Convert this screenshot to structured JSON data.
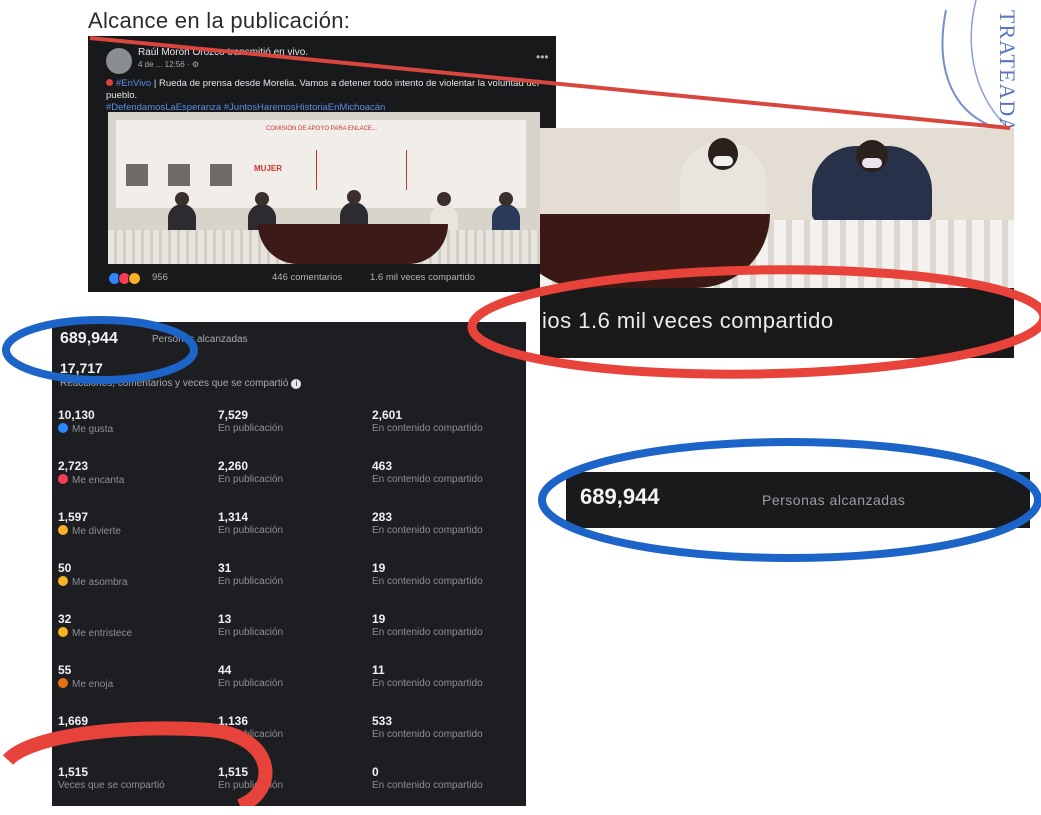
{
  "heading": "Alcance en la publicación:",
  "post": {
    "author": "Raúl Morón Orozco transmitió en vivo.",
    "time": "4 de ... 12:56 · ⚙",
    "live_tag": "#EnVivo",
    "text": "| Rueda de prensa desde Morelia. Vamos a detener todo intento de violentar la voluntad del pueblo.",
    "hashtags": "#DefendamosLaEsperanza #JuntosHaremosHistoriaEnMichoacán",
    "reaction_count": "956",
    "comments": "446 comentarios",
    "shares": "1.6 mil veces compartido",
    "banner_title": "COMISIÓN DE APOYO PARA ENLACE...",
    "banner_word": "MUJER"
  },
  "zoom_caption": "ios  1.6 mil veces compartido",
  "stats": {
    "reach_value": "689,944",
    "reach_label": "Personas alcanzadas",
    "engagement_value": "17,717",
    "engagement_label": "Reacciones, comentarios y veces que se compartió",
    "rows": [
      {
        "total": "10,130",
        "total_label": "Me gusta",
        "icon": "like-icon",
        "color": "#2d88ff",
        "post": "7,529",
        "post_label": "En publicación",
        "shared": "2,601",
        "shared_label": "En contenido compartido"
      },
      {
        "total": "2,723",
        "total_label": "Me encanta",
        "icon": "love-icon",
        "color": "#f33e58",
        "post": "2,260",
        "post_label": "En publicación",
        "shared": "463",
        "shared_label": "En contenido compartido"
      },
      {
        "total": "1,597",
        "total_label": "Me divierte",
        "icon": "haha-icon",
        "color": "#f7b125",
        "post": "1,314",
        "post_label": "En publicación",
        "shared": "283",
        "shared_label": "En contenido compartido"
      },
      {
        "total": "50",
        "total_label": "Me asombra",
        "icon": "wow-icon",
        "color": "#f7b125",
        "post": "31",
        "post_label": "En publicación",
        "shared": "19",
        "shared_label": "En contenido compartido"
      },
      {
        "total": "32",
        "total_label": "Me entristece",
        "icon": "sad-icon",
        "color": "#f7b125",
        "post": "13",
        "post_label": "En publicación",
        "shared": "19",
        "shared_label": "En contenido compartido"
      },
      {
        "total": "55",
        "total_label": "Me enoja",
        "icon": "angry-icon",
        "color": "#e9710f",
        "post": "44",
        "post_label": "En publicación",
        "shared": "11",
        "shared_label": "En contenido compartido"
      },
      {
        "total": "1,669",
        "total_label": "",
        "icon": "",
        "color": "",
        "post": "1,136",
        "post_label": "En publicación",
        "shared": "533",
        "shared_label": "En contenido compartido"
      },
      {
        "total": "1,515",
        "total_label": "Veces que se compartió",
        "icon": "",
        "color": "",
        "post": "1,515",
        "post_label": "En publicación",
        "shared": "0",
        "shared_label": "En contenido compartido"
      }
    ]
  },
  "stamp_text": "TRATEADA",
  "colors": {
    "circle_red": "#e8433a",
    "circle_blue": "#1c64c8",
    "line_red": "#d8463e"
  }
}
